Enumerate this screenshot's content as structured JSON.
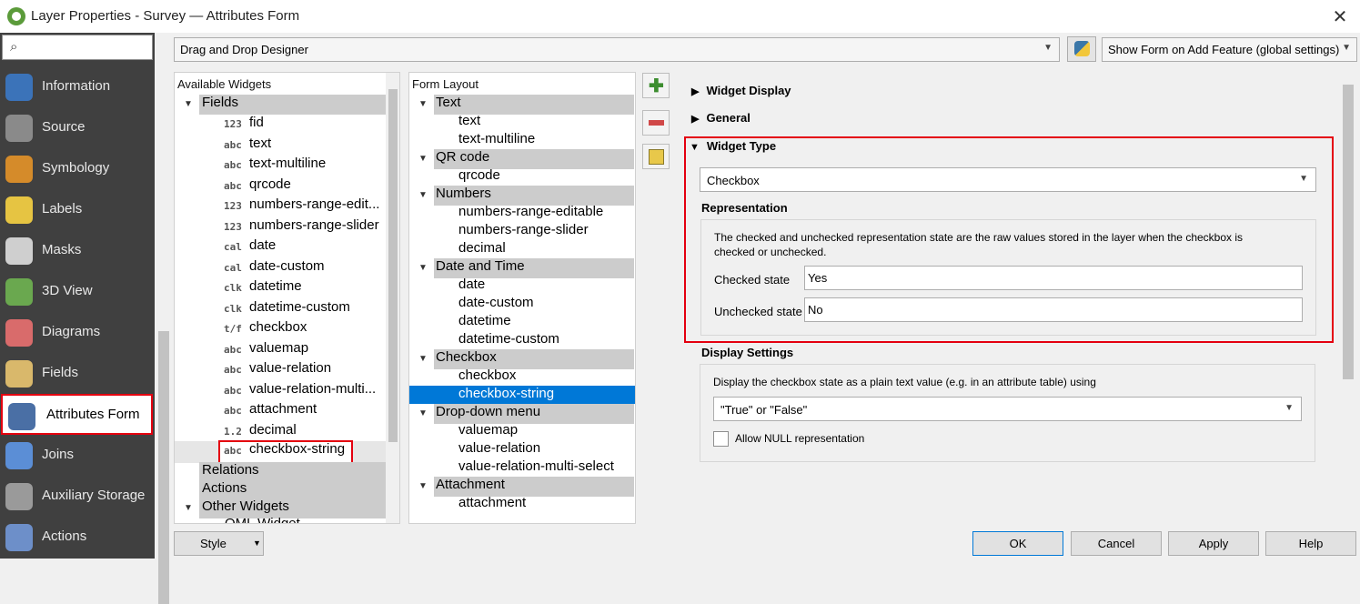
{
  "window": {
    "title": "Layer Properties - Survey — Attributes Form",
    "close_glyph": "✕"
  },
  "nav": {
    "search_icon": "search-icon",
    "items": [
      {
        "label": "Information",
        "icon": "info-icon",
        "color": "#3b73b9"
      },
      {
        "label": "Source",
        "icon": "source-icon",
        "color": "#8a8a8a"
      },
      {
        "label": "Symbology",
        "icon": "symbology-icon",
        "color": "#d58b2a"
      },
      {
        "label": "Labels",
        "icon": "labels-icon",
        "color": "#e6c442"
      },
      {
        "label": "Masks",
        "icon": "masks-icon",
        "color": "#cfcfcf"
      },
      {
        "label": "3D View",
        "icon": "3d-view-icon",
        "color": "#6aa84f"
      },
      {
        "label": "Diagrams",
        "icon": "diagrams-icon",
        "color": "#d96b6b"
      },
      {
        "label": "Fields",
        "icon": "fields-icon",
        "color": "#d9b86b"
      },
      {
        "label": "Attributes Form",
        "icon": "attributes-form-icon",
        "color": "#4a6fa5"
      },
      {
        "label": "Joins",
        "icon": "joins-icon",
        "color": "#5b8ed6"
      },
      {
        "label": "Auxiliary Storage",
        "icon": "auxiliary-storage-icon",
        "color": "#9a9a9a"
      },
      {
        "label": "Actions",
        "icon": "actions-icon",
        "color": "#6d8fc9"
      }
    ]
  },
  "toolbar": {
    "designer": "Drag and Drop Designer",
    "show_form": "Show Form on Add Feature (global settings)"
  },
  "available": {
    "header": "Available Widgets",
    "fields_label": "Fields",
    "fields": [
      {
        "tag": "123",
        "name": "fid"
      },
      {
        "tag": "abc",
        "name": "text"
      },
      {
        "tag": "abc",
        "name": "text-multiline"
      },
      {
        "tag": "abc",
        "name": "qrcode"
      },
      {
        "tag": "123",
        "name": "numbers-range-edit..."
      },
      {
        "tag": "123",
        "name": "numbers-range-slider"
      },
      {
        "tag": "cal",
        "name": "date"
      },
      {
        "tag": "cal",
        "name": "date-custom"
      },
      {
        "tag": "clk",
        "name": "datetime"
      },
      {
        "tag": "clk",
        "name": "datetime-custom"
      },
      {
        "tag": "t/f",
        "name": "checkbox"
      },
      {
        "tag": "abc",
        "name": "valuemap"
      },
      {
        "tag": "abc",
        "name": "value-relation"
      },
      {
        "tag": "abc",
        "name": "value-relation-multi..."
      },
      {
        "tag": "abc",
        "name": "attachment"
      },
      {
        "tag": "1.2",
        "name": "decimal"
      },
      {
        "tag": "abc",
        "name": "checkbox-string"
      }
    ],
    "relations": "Relations",
    "actions": "Actions",
    "other_widgets": "Other Widgets",
    "qml_widget": "QML Widget"
  },
  "layout": {
    "header": "Form Layout",
    "groups": [
      {
        "name": "Text",
        "items": [
          "text",
          "text-multiline"
        ]
      },
      {
        "name": "QR code",
        "items": [
          "qrcode"
        ]
      },
      {
        "name": "Numbers",
        "items": [
          "numbers-range-editable",
          "numbers-range-slider",
          "decimal"
        ]
      },
      {
        "name": "Date and Time",
        "items": [
          "date",
          "date-custom",
          "datetime",
          "datetime-custom"
        ]
      },
      {
        "name": "Checkbox",
        "items": [
          "checkbox",
          "checkbox-string"
        ]
      },
      {
        "name": "Drop-down menu",
        "items": [
          "valuemap",
          "value-relation",
          "value-relation-multi-select"
        ]
      },
      {
        "name": "Attachment",
        "items": [
          "attachment"
        ]
      }
    ]
  },
  "config": {
    "widget_display": "Widget Display",
    "general": "General",
    "widget_type": "Widget Type",
    "widget_type_value": "Checkbox",
    "representation": "Representation",
    "representation_desc_1": "The checked and unchecked representation state are the raw values stored in the layer when the checkbox is",
    "representation_desc_2": "checked or unchecked.",
    "checked_label": "Checked state",
    "checked_value": "Yes",
    "unchecked_label": "Unchecked state",
    "unchecked_value": "No",
    "display_settings": "Display Settings",
    "display_desc": "Display the checkbox state as a plain text value (e.g. in an attribute table) using",
    "display_value": "\"True\" or \"False\"",
    "allow_null": "Allow NULL representation"
  },
  "bottom": {
    "style": "Style",
    "ok": "OK",
    "cancel": "Cancel",
    "apply": "Apply",
    "help": "Help"
  },
  "colors": {
    "highlight": "#e4000f",
    "selection": "#0078d7"
  }
}
